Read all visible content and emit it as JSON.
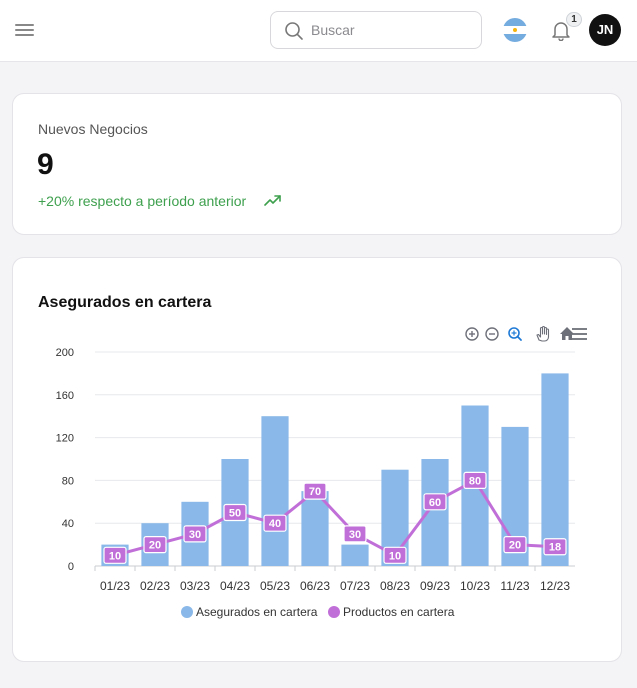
{
  "header": {
    "search_placeholder": "Buscar",
    "notification_count": "1",
    "avatar_initials": "JN",
    "icons": [
      "menu-icon",
      "search-icon",
      "argentina-flag-icon",
      "bell-icon"
    ]
  },
  "kpi": {
    "label": "Nuevos Negocios",
    "value": "9",
    "delta_text": "+20% respecto a período anterior",
    "delta_color": "#3ea04e"
  },
  "chart_card": {
    "title": "Asegurados en cartera",
    "toolbar": [
      "zoom-in-icon",
      "zoom-out-icon",
      "selection-zoom-icon",
      "pan-hand-icon",
      "reset-home-icon",
      "menu-icon"
    ]
  },
  "chart_data": {
    "type": "bar",
    "categories": [
      "01/23",
      "02/23",
      "03/23",
      "04/23",
      "05/23",
      "06/23",
      "07/23",
      "08/23",
      "09/23",
      "10/23",
      "11/23",
      "12/23"
    ],
    "series": [
      {
        "name": "Asegurados en cartera",
        "type": "bar",
        "color": "#8ab8e8",
        "values": [
          20,
          40,
          60,
          100,
          140,
          70,
          20,
          90,
          100,
          150,
          130,
          180
        ]
      },
      {
        "name": "Productos en cartera",
        "type": "line",
        "color": "#c16fd8",
        "values": [
          10,
          20,
          30,
          50,
          40,
          70,
          30,
          10,
          60,
          80,
          20,
          18
        ]
      }
    ],
    "ylim": [
      0,
      200
    ],
    "yticks": [
      0,
      40,
      80,
      120,
      160,
      200
    ],
    "grid": true,
    "legend": "bottom"
  }
}
